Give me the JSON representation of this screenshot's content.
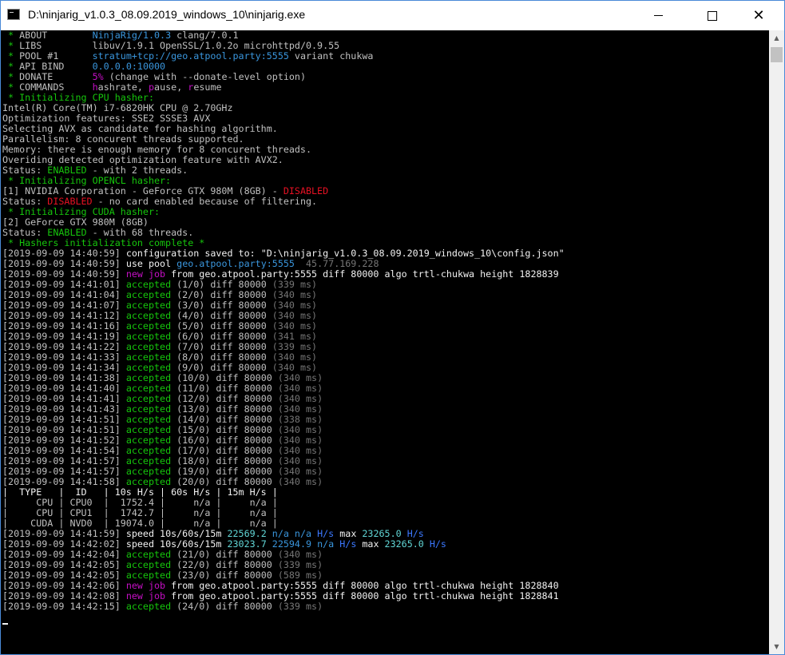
{
  "window": {
    "title": "D:\\ninjarig_v1.0.3_08.09.2019_windows_10\\ninjarig.exe",
    "minimize_label": "minimize",
    "maximize_label": "maximize",
    "close_glyph": "✕"
  },
  "colors": {
    "console_bg": "#000000",
    "console_text": "#c0c0c0",
    "accepted_green": "#16c60c",
    "job_magenta": "#c50fc5",
    "disabled_red": "#e81123",
    "speed_cyan": "#3a96dd"
  },
  "console": {
    "lines": [
      [
        {
          "t": " * ",
          "c": "g"
        },
        {
          "t": "ABOUT        "
        },
        {
          "t": "NinjaRig/1.0.3",
          "c": "c"
        },
        {
          "t": " clang/7.0.1"
        }
      ],
      [
        {
          "t": " * ",
          "c": "g"
        },
        {
          "t": "LIBS         libuv/1.9.1 OpenSSL/1.0.2o microhttpd/0.9.55"
        }
      ],
      [
        {
          "t": " * ",
          "c": "g"
        },
        {
          "t": "POOL #1      "
        },
        {
          "t": "stratum+tcp://geo.atpool.party:5555",
          "c": "c"
        },
        {
          "t": " variant chukwa"
        }
      ],
      [
        {
          "t": " * ",
          "c": "g"
        },
        {
          "t": "API BIND     "
        },
        {
          "t": "0.0.0.0:10000",
          "c": "c"
        }
      ],
      [
        {
          "t": " * ",
          "c": "g"
        },
        {
          "t": "DONATE       "
        },
        {
          "t": "5%",
          "c": "m"
        },
        {
          "t": " (change with --donate-level option)"
        }
      ],
      [
        {
          "t": " * ",
          "c": "g"
        },
        {
          "t": "COMMANDS     "
        },
        {
          "t": "h",
          "c": "m"
        },
        {
          "t": "ashrate, "
        },
        {
          "t": "p",
          "c": "m"
        },
        {
          "t": "ause, "
        },
        {
          "t": "r",
          "c": "m"
        },
        {
          "t": "esume"
        }
      ],
      [
        {
          "t": " * Initializing CPU hasher:",
          "c": "g"
        }
      ],
      [
        {
          "t": "Intel(R) Core(TM) i7-6820HK CPU @ 2.70GHz"
        }
      ],
      [
        {
          "t": "Optimization features: SSE2 SSSE3 AVX"
        }
      ],
      [
        {
          "t": "Selecting AVX as candidate for hashing algorithm."
        }
      ],
      [
        {
          "t": "Parallelism: 8 concurent threads supported."
        }
      ],
      [
        {
          "t": "Memory: there is enough memory for 8 concurent threads."
        }
      ],
      [
        {
          "t": "Overiding detected optimization feature with AVX2."
        }
      ],
      [
        {
          "t": "Status: "
        },
        {
          "t": "ENABLED",
          "c": "g"
        },
        {
          "t": " - with 2 threads."
        }
      ],
      [
        {
          "t": " * Initializing OPENCL hasher:",
          "c": "g"
        }
      ],
      [
        {
          "t": "[1] NVIDIA Corporation - GeForce GTX 980M (8GB) - "
        },
        {
          "t": "DISABLED",
          "c": "r"
        }
      ],
      [
        {
          "t": "Status: "
        },
        {
          "t": "DISABLED",
          "c": "r"
        },
        {
          "t": " - no card enabled because of filtering."
        }
      ],
      [
        {
          "t": " * Initializing CUDA hasher:",
          "c": "g"
        }
      ],
      [
        {
          "t": "[2] GeForce GTX 980M (8GB)"
        }
      ],
      [
        {
          "t": "Status: "
        },
        {
          "t": "ENABLED",
          "c": "g"
        },
        {
          "t": " - with 68 threads."
        }
      ],
      [
        {
          "t": " * Hashers initialization complete *",
          "c": "g"
        }
      ],
      [
        {
          "t": "[2019-09-09 14:40:59] "
        },
        {
          "t": "configuration saved to: \"D:\\ninjarig_v1.0.3_08.09.2019_windows_10\\config.json\"",
          "c": "w"
        }
      ],
      [
        {
          "t": "[2019-09-09 14:40:59] "
        },
        {
          "t": "use pool ",
          "c": "w"
        },
        {
          "t": "geo.atpool.party:5555",
          "c": "c"
        },
        {
          "t": "  45.77.169.228",
          "c": "dg"
        }
      ],
      [
        {
          "t": "[2019-09-09 14:40:59] "
        },
        {
          "t": "new job",
          "c": "m"
        },
        {
          "t": " from geo.atpool.party:5555 diff 80000 algo trtl-chukwa height 1828839",
          "c": "w"
        }
      ],
      [
        {
          "t": "[2019-09-09 14:41:01] "
        },
        {
          "t": "accepted",
          "c": "g"
        },
        {
          "t": " (1/0) diff 80000 "
        },
        {
          "t": "(339 ms)",
          "c": "dg"
        }
      ],
      [
        {
          "t": "[2019-09-09 14:41:04] "
        },
        {
          "t": "accepted",
          "c": "g"
        },
        {
          "t": " (2/0) diff 80000 "
        },
        {
          "t": "(340 ms)",
          "c": "dg"
        }
      ],
      [
        {
          "t": "[2019-09-09 14:41:07] "
        },
        {
          "t": "accepted",
          "c": "g"
        },
        {
          "t": " (3/0) diff 80000 "
        },
        {
          "t": "(340 ms)",
          "c": "dg"
        }
      ],
      [
        {
          "t": "[2019-09-09 14:41:12] "
        },
        {
          "t": "accepted",
          "c": "g"
        },
        {
          "t": " (4/0) diff 80000 "
        },
        {
          "t": "(340 ms)",
          "c": "dg"
        }
      ],
      [
        {
          "t": "[2019-09-09 14:41:16] "
        },
        {
          "t": "accepted",
          "c": "g"
        },
        {
          "t": " (5/0) diff 80000 "
        },
        {
          "t": "(340 ms)",
          "c": "dg"
        }
      ],
      [
        {
          "t": "[2019-09-09 14:41:19] "
        },
        {
          "t": "accepted",
          "c": "g"
        },
        {
          "t": " (6/0) diff 80000 "
        },
        {
          "t": "(341 ms)",
          "c": "dg"
        }
      ],
      [
        {
          "t": "[2019-09-09 14:41:22] "
        },
        {
          "t": "accepted",
          "c": "g"
        },
        {
          "t": " (7/0) diff 80000 "
        },
        {
          "t": "(339 ms)",
          "c": "dg"
        }
      ],
      [
        {
          "t": "[2019-09-09 14:41:33] "
        },
        {
          "t": "accepted",
          "c": "g"
        },
        {
          "t": " (8/0) diff 80000 "
        },
        {
          "t": "(340 ms)",
          "c": "dg"
        }
      ],
      [
        {
          "t": "[2019-09-09 14:41:34] "
        },
        {
          "t": "accepted",
          "c": "g"
        },
        {
          "t": " (9/0) diff 80000 "
        },
        {
          "t": "(340 ms)",
          "c": "dg"
        }
      ],
      [
        {
          "t": "[2019-09-09 14:41:38] "
        },
        {
          "t": "accepted",
          "c": "g"
        },
        {
          "t": " (10/0) diff 80000 "
        },
        {
          "t": "(340 ms)",
          "c": "dg"
        }
      ],
      [
        {
          "t": "[2019-09-09 14:41:40] "
        },
        {
          "t": "accepted",
          "c": "g"
        },
        {
          "t": " (11/0) diff 80000 "
        },
        {
          "t": "(340 ms)",
          "c": "dg"
        }
      ],
      [
        {
          "t": "[2019-09-09 14:41:41] "
        },
        {
          "t": "accepted",
          "c": "g"
        },
        {
          "t": " (12/0) diff 80000 "
        },
        {
          "t": "(340 ms)",
          "c": "dg"
        }
      ],
      [
        {
          "t": "[2019-09-09 14:41:43] "
        },
        {
          "t": "accepted",
          "c": "g"
        },
        {
          "t": " (13/0) diff 80000 "
        },
        {
          "t": "(340 ms)",
          "c": "dg"
        }
      ],
      [
        {
          "t": "[2019-09-09 14:41:51] "
        },
        {
          "t": "accepted",
          "c": "g"
        },
        {
          "t": " (14/0) diff 80000 "
        },
        {
          "t": "(338 ms)",
          "c": "dg"
        }
      ],
      [
        {
          "t": "[2019-09-09 14:41:51] "
        },
        {
          "t": "accepted",
          "c": "g"
        },
        {
          "t": " (15/0) diff 80000 "
        },
        {
          "t": "(340 ms)",
          "c": "dg"
        }
      ],
      [
        {
          "t": "[2019-09-09 14:41:52] "
        },
        {
          "t": "accepted",
          "c": "g"
        },
        {
          "t": " (16/0) diff 80000 "
        },
        {
          "t": "(340 ms)",
          "c": "dg"
        }
      ],
      [
        {
          "t": "[2019-09-09 14:41:54] "
        },
        {
          "t": "accepted",
          "c": "g"
        },
        {
          "t": " (17/0) diff 80000 "
        },
        {
          "t": "(340 ms)",
          "c": "dg"
        }
      ],
      [
        {
          "t": "[2019-09-09 14:41:57] "
        },
        {
          "t": "accepted",
          "c": "g"
        },
        {
          "t": " (18/0) diff 80000 "
        },
        {
          "t": "(340 ms)",
          "c": "dg"
        }
      ],
      [
        {
          "t": "[2019-09-09 14:41:57] "
        },
        {
          "t": "accepted",
          "c": "g"
        },
        {
          "t": " (19/0) diff 80000 "
        },
        {
          "t": "(340 ms)",
          "c": "dg"
        }
      ],
      [
        {
          "t": "[2019-09-09 14:41:58] "
        },
        {
          "t": "accepted",
          "c": "g"
        },
        {
          "t": " (20/0) diff 80000 "
        },
        {
          "t": "(340 ms)",
          "c": "dg"
        }
      ],
      [
        {
          "t": "|  TYPE   |  ID   | 10s H/s | 60s H/s | 15m H/s |",
          "c": "w"
        }
      ],
      [
        {
          "t": "|     CPU | CPU0  |  1752.4 |     n/a |     n/a |"
        }
      ],
      [
        {
          "t": "|     CPU | CPU1  |  1742.7 |     n/a |     n/a |"
        }
      ],
      [
        {
          "t": "|    CUDA | NVD0  | 19074.0 |     n/a |     n/a |"
        }
      ],
      [
        {
          "t": "[2019-09-09 14:41:59] "
        },
        {
          "t": "speed 10s/60s/15m ",
          "c": "w"
        },
        {
          "t": "22569.2",
          "c": "cb"
        },
        {
          "t": " n/a n/a",
          "c": "c"
        },
        {
          "t": " H/s",
          "c": "tblue"
        },
        {
          "t": " max ",
          "c": "w"
        },
        {
          "t": "23265.0",
          "c": "cb"
        },
        {
          "t": " H/s",
          "c": "tblue"
        }
      ],
      [
        {
          "t": "[2019-09-09 14:42:02] "
        },
        {
          "t": "speed 10s/60s/15m ",
          "c": "w"
        },
        {
          "t": "23023.7",
          "c": "cb"
        },
        {
          "t": " 22594.9 n/a",
          "c": "c"
        },
        {
          "t": " H/s",
          "c": "tblue"
        },
        {
          "t": " max ",
          "c": "w"
        },
        {
          "t": "23265.0",
          "c": "cb"
        },
        {
          "t": " H/s",
          "c": "tblue"
        }
      ],
      [
        {
          "t": "[2019-09-09 14:42:04] "
        },
        {
          "t": "accepted",
          "c": "g"
        },
        {
          "t": " (21/0) diff 80000 "
        },
        {
          "t": "(340 ms)",
          "c": "dg"
        }
      ],
      [
        {
          "t": "[2019-09-09 14:42:05] "
        },
        {
          "t": "accepted",
          "c": "g"
        },
        {
          "t": " (22/0) diff 80000 "
        },
        {
          "t": "(339 ms)",
          "c": "dg"
        }
      ],
      [
        {
          "t": "[2019-09-09 14:42:05] "
        },
        {
          "t": "accepted",
          "c": "g"
        },
        {
          "t": " (23/0) diff 80000 "
        },
        {
          "t": "(589 ms)",
          "c": "dg"
        }
      ],
      [
        {
          "t": "[2019-09-09 14:42:06] "
        },
        {
          "t": "new job",
          "c": "m"
        },
        {
          "t": " from geo.atpool.party:5555 diff 80000 algo trtl-chukwa height 1828840",
          "c": "w"
        }
      ],
      [
        {
          "t": "[2019-09-09 14:42:08] "
        },
        {
          "t": "new job",
          "c": "m"
        },
        {
          "t": " from geo.atpool.party:5555 diff 80000 algo trtl-chukwa height 1828841",
          "c": "w"
        }
      ],
      [
        {
          "t": "[2019-09-09 14:42:15] "
        },
        {
          "t": "accepted",
          "c": "g"
        },
        {
          "t": " (24/0) diff 80000 "
        },
        {
          "t": "(339 ms)",
          "c": "dg"
        }
      ]
    ]
  }
}
